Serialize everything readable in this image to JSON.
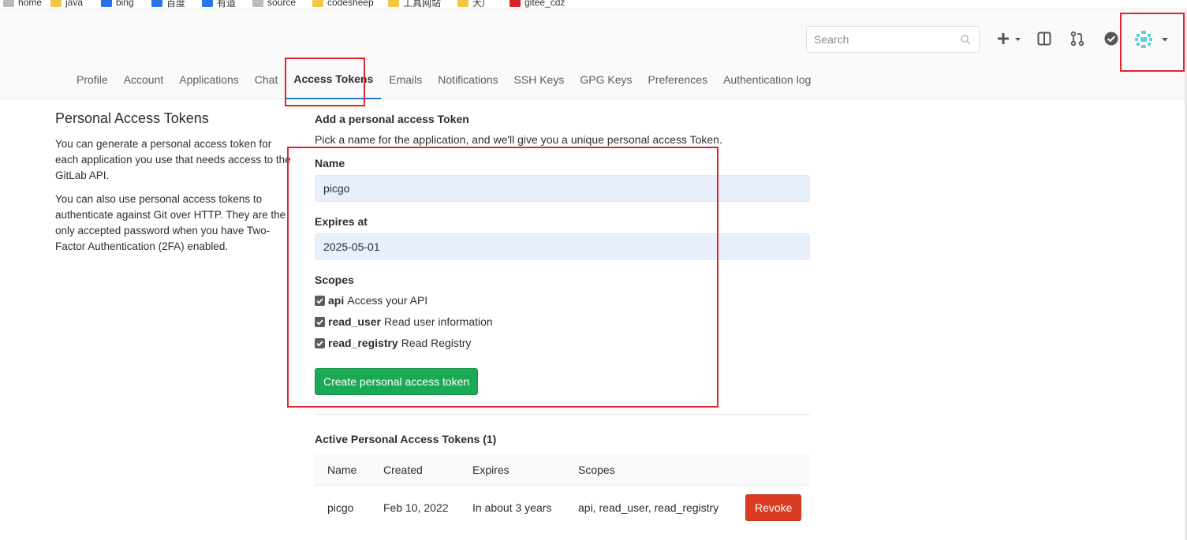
{
  "bookmarks": [
    {
      "label": "home",
      "icon": "plain"
    },
    {
      "label": "java",
      "icon": "folder"
    },
    {
      "label": "bing",
      "icon": "blue"
    },
    {
      "label": "百度",
      "icon": "blue"
    },
    {
      "label": "有道",
      "icon": "blue"
    },
    {
      "label": "source",
      "icon": "plain"
    },
    {
      "label": "codesheep",
      "icon": "folder"
    },
    {
      "label": "工具网站",
      "icon": "folder"
    },
    {
      "label": "大厂",
      "icon": "folder"
    },
    {
      "label": "gitee_cdz",
      "icon": "red"
    }
  ],
  "header": {
    "search_placeholder": "Search",
    "icons": [
      "plus-icon",
      "sidebar-panel-icon",
      "merge-request-icon",
      "todo-check-icon"
    ],
    "avatar": "identicon-avatar"
  },
  "tabs": [
    {
      "label": "Profile",
      "active": false
    },
    {
      "label": "Account",
      "active": false
    },
    {
      "label": "Applications",
      "active": false
    },
    {
      "label": "Chat",
      "active": false
    },
    {
      "label": "Access Tokens",
      "active": true
    },
    {
      "label": "Emails",
      "active": false
    },
    {
      "label": "Notifications",
      "active": false
    },
    {
      "label": "SSH Keys",
      "active": false
    },
    {
      "label": "GPG Keys",
      "active": false
    },
    {
      "label": "Preferences",
      "active": false
    },
    {
      "label": "Authentication log",
      "active": false
    }
  ],
  "left": {
    "title": "Personal Access Tokens",
    "para1": "You can generate a personal access token for each application you use that needs access to the GitLab API.",
    "para2": "You can also use personal access tokens to authenticate against Git over HTTP. They are the only accepted password when you have Two-Factor Authentication (2FA) enabled."
  },
  "form": {
    "title": "Add a personal access Token",
    "subtitle": "Pick a name for the application, and we'll give you a unique personal access Token.",
    "name_label": "Name",
    "name_value": "picgo",
    "expires_label": "Expires at",
    "expires_value": "2025-05-01",
    "scopes_label": "Scopes",
    "scopes": [
      {
        "name": "api",
        "desc": "Access your API",
        "checked": true
      },
      {
        "name": "read_user",
        "desc": "Read user information",
        "checked": true
      },
      {
        "name": "read_registry",
        "desc": "Read Registry",
        "checked": true
      }
    ],
    "create_button": "Create personal access token"
  },
  "active_tokens": {
    "title": "Active Personal Access Tokens (1)",
    "columns": [
      "Name",
      "Created",
      "Expires",
      "Scopes"
    ],
    "rows": [
      {
        "name": "picgo",
        "created": "Feb 10, 2022",
        "expires": "In about 3 years",
        "scopes": "api, read_user, read_registry",
        "action": "Revoke"
      }
    ]
  },
  "colors": {
    "accent": "#1f78d1",
    "create_button": "#1aaa55",
    "revoke_button": "#db3b21",
    "annotation": "#e0262c"
  }
}
